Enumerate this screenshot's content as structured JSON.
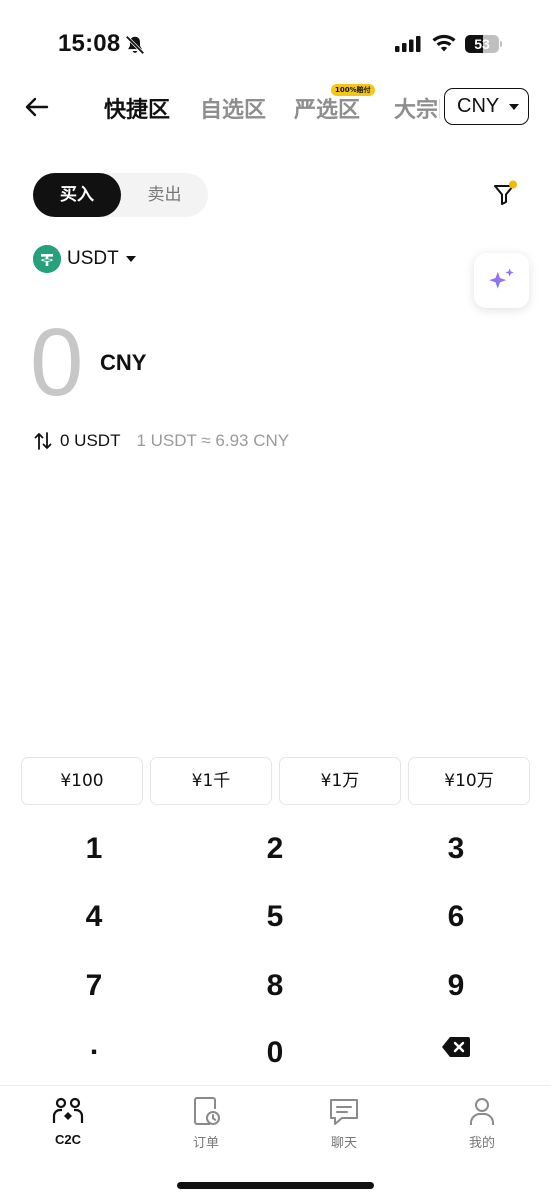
{
  "status_bar": {
    "time": "15:08",
    "battery_level": "53",
    "battery_percent": 53
  },
  "nav": {
    "tabs": [
      {
        "label": "快捷区",
        "active": true
      },
      {
        "label": "自选区",
        "active": false
      },
      {
        "label": "严选区",
        "active": false,
        "badge": "100%赔付"
      },
      {
        "label": "大宗区",
        "active": false
      }
    ],
    "currency": "CNY"
  },
  "trade": {
    "buy_label": "买入",
    "sell_label": "卖出",
    "active": "buy"
  },
  "coin": {
    "symbol": "USDT"
  },
  "amount": {
    "value": "0",
    "currency": "CNY",
    "converted": "0 USDT",
    "rate": "1 USDT ≈ 6.93 CNY"
  },
  "quick_amounts": [
    "¥100",
    "¥1千",
    "¥1万",
    "¥10万"
  ],
  "keypad": {
    "keys": [
      "1",
      "2",
      "3",
      "4",
      "5",
      "6",
      "7",
      "8",
      "9",
      ".",
      "0"
    ]
  },
  "bottom_nav": [
    {
      "label": "C2C",
      "icon": "c2c-people-icon",
      "active": true
    },
    {
      "label": "订单",
      "icon": "orders-icon",
      "active": false
    },
    {
      "label": "聊天",
      "icon": "chat-icon",
      "active": false
    },
    {
      "label": "我的",
      "icon": "profile-icon",
      "active": false
    }
  ],
  "colors": {
    "accent_dot": "#f5b800",
    "tether_green": "#26a17b",
    "ai_gradient_start": "#5b7cfa",
    "ai_gradient_end": "#c36bf5"
  }
}
